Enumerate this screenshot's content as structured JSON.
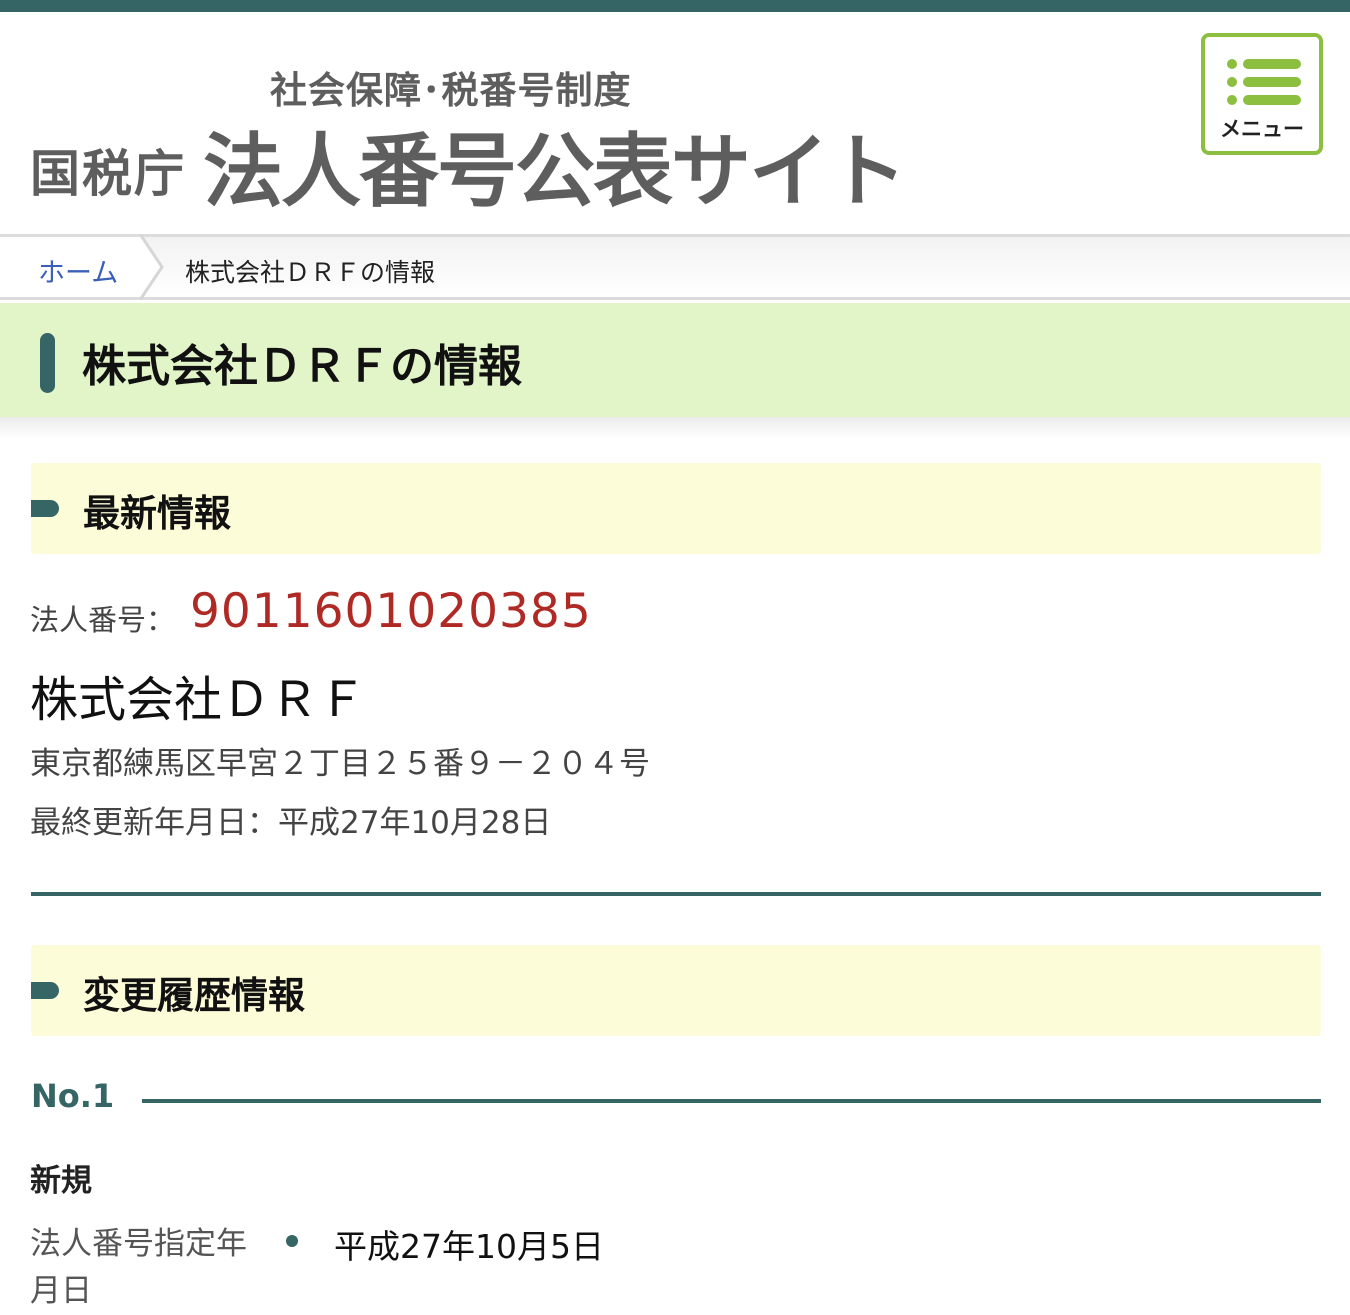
{
  "header": {
    "subtitle": "社会保障･税番号制度",
    "agency": "国税庁",
    "site_title": "法人番号公表サイト",
    "menu_label": "メニュー"
  },
  "breadcrumb": {
    "home": "ホーム",
    "current": "株式会社ＤＲＦの情報"
  },
  "page_title": "株式会社ＤＲＦの情報",
  "latest": {
    "heading": "最新情報",
    "number_label": "法人番号：",
    "number_value": "9011601020385",
    "name": "株式会社ＤＲＦ",
    "address": "東京都練馬区早宮２丁目２５番９－２０４号",
    "updated": "最終更新年月日：平成27年10月28日"
  },
  "history": {
    "heading": "変更履歴情報",
    "entries": [
      {
        "no": "No.1",
        "kind": "新規",
        "date_label": "法人番号指定年月日",
        "date_value": "平成27年10月5日"
      }
    ]
  },
  "colors": {
    "accent": "#356565",
    "menu_green": "#8cbf3f",
    "number_red": "#b02a25",
    "title_band": "#e2f5c8",
    "section_bg": "#fdfcd9"
  },
  "icons": {
    "menu": "hamburger-list-icon",
    "breadcrumb_separator": "chevron-right-icon",
    "list_bullet": "bullet-dot-icon"
  }
}
